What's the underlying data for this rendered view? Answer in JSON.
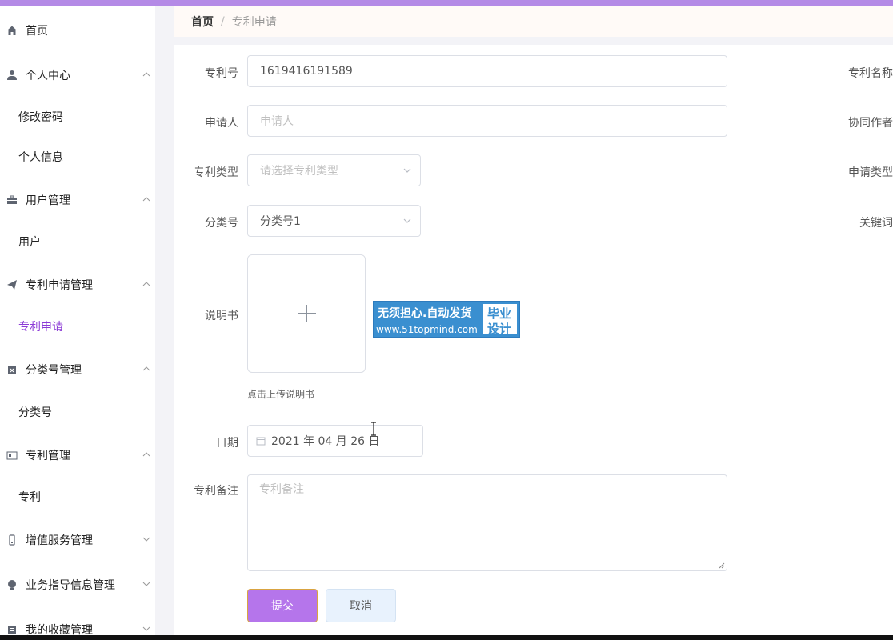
{
  "sidebar": {
    "items": [
      {
        "label": "首页",
        "icon": "home-icon"
      },
      {
        "label": "个人中心",
        "icon": "user-icon",
        "subitems": [
          "修改密码",
          "个人信息"
        ]
      },
      {
        "label": "用户管理",
        "icon": "briefcase-icon",
        "subitems": [
          "用户"
        ]
      },
      {
        "label": "专利申请管理",
        "icon": "paper-plane-icon",
        "subitems": [
          "专利申请"
        ]
      },
      {
        "label": "分类号管理",
        "icon": "clipboard-icon",
        "subitems": [
          "分类号"
        ]
      },
      {
        "label": "专利管理",
        "icon": "id-card-icon",
        "subitems": [
          "专利"
        ]
      },
      {
        "label": "增值服务管理",
        "icon": "phone-icon"
      },
      {
        "label": "业务指导信息管理",
        "icon": "bulb-icon"
      },
      {
        "label": "我的收藏管理",
        "icon": "clipboard-list-icon"
      }
    ],
    "active_subitem": "专利申请"
  },
  "breadcrumb": {
    "home": "首页",
    "separator": "/",
    "current": "专利申请"
  },
  "form": {
    "patent_no": {
      "label": "专利号",
      "value": "1619416191589"
    },
    "applicant": {
      "label": "申请人",
      "placeholder": "申请人"
    },
    "patent_type": {
      "label": "专利类型",
      "placeholder": "请选择专利类型"
    },
    "category_no": {
      "label": "分类号",
      "value": "分类号1"
    },
    "manual": {
      "label": "说明书",
      "hint": "点击上传说明书"
    },
    "date": {
      "label": "日期",
      "value": "2021 年 04 月 26 日"
    },
    "remark": {
      "label": "专利备注",
      "placeholder": "专利备注"
    },
    "right_labels": [
      "专利名称",
      "协同作者",
      "申请类型",
      "关键词"
    ],
    "submit_label": "提交",
    "cancel_label": "取消"
  },
  "banner": {
    "line1": "无须担心.自动发货",
    "line2": "www.51topmind.com",
    "box1": "毕业",
    "box2": "设计"
  },
  "colors": {
    "accent": "#b575eb",
    "active_menu": "#8c3bd6",
    "topbar": "#b48ae6"
  }
}
